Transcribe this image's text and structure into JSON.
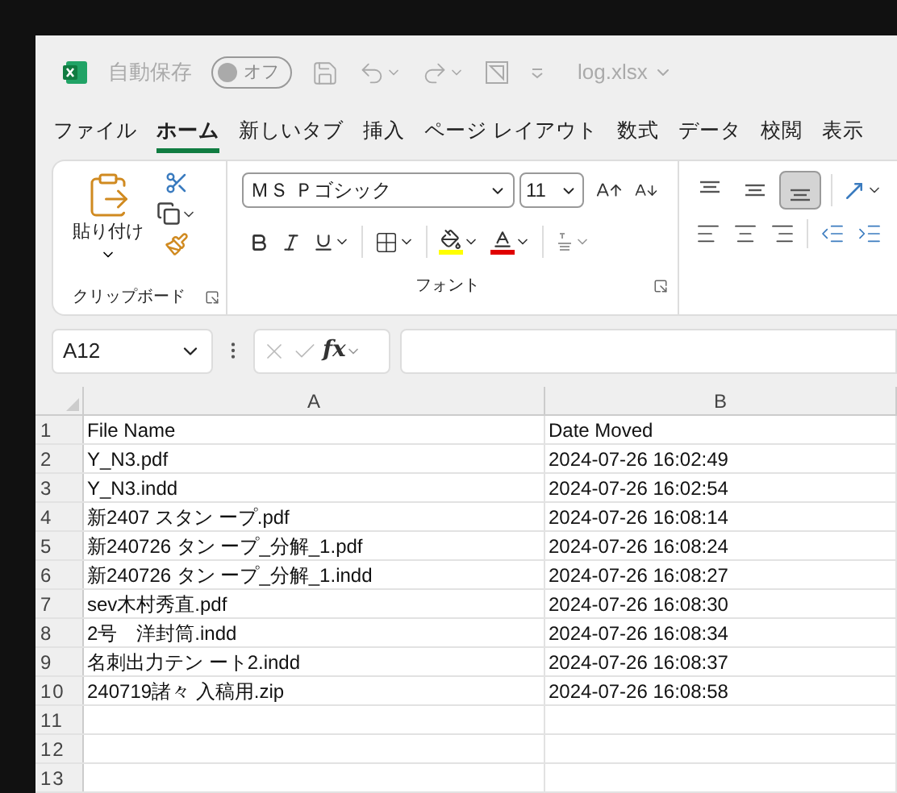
{
  "title_bar": {
    "autosave_label": "自動保存",
    "autosave_toggle": {
      "label": "オフ",
      "on": false
    },
    "filename": "log.xlsx"
  },
  "tabs": [
    {
      "label": "ファイル",
      "selected": false
    },
    {
      "label": "ホーム",
      "selected": true
    },
    {
      "label": "新しいタブ",
      "selected": false
    },
    {
      "label": "挿入",
      "selected": false
    },
    {
      "label": "ページ レイアウト",
      "selected": false
    },
    {
      "label": "数式",
      "selected": false
    },
    {
      "label": "データ",
      "selected": false
    },
    {
      "label": "校閲",
      "selected": false
    },
    {
      "label": "表示",
      "selected": false
    }
  ],
  "ribbon": {
    "clipboard": {
      "paste_label": "貼り付け",
      "group_label": "クリップボード"
    },
    "font": {
      "font_name": "ＭＳ Ｐゴシック",
      "font_size": "11",
      "group_label": "フォント"
    },
    "alignment": {
      "vertical_buttons": [
        {
          "selected": false
        },
        {
          "selected": false
        },
        {
          "selected": true
        }
      ]
    }
  },
  "formula_bar": {
    "name_box": "A12",
    "fx": "fx"
  },
  "sheet": {
    "columns": [
      "A",
      "B"
    ],
    "rows": [
      {
        "number": "1",
        "cells": [
          "File Name",
          "Date Moved"
        ]
      },
      {
        "number": "2",
        "cells": [
          "Y_N3.pdf",
          "2024-07-26 16:02:49"
        ]
      },
      {
        "number": "3",
        "cells": [
          "Y_N3.indd",
          "2024-07-26 16:02:54"
        ]
      },
      {
        "number": "4",
        "cells": [
          "新2407 スタン ープ.pdf",
          "2024-07-26 16:08:14"
        ]
      },
      {
        "number": "5",
        "cells": [
          "新240726 タン ープ_分解_1.pdf",
          "2024-07-26 16:08:24"
        ]
      },
      {
        "number": "6",
        "cells": [
          "新240726 タン ープ_分解_1.indd",
          "2024-07-26 16:08:27"
        ]
      },
      {
        "number": "7",
        "cells": [
          "sev木村秀直.pdf",
          "2024-07-26 16:08:30"
        ]
      },
      {
        "number": "8",
        "cells": [
          "2号　洋封筒.indd",
          "2024-07-26 16:08:34"
        ]
      },
      {
        "number": "9",
        "cells": [
          "名刺出力テン ート2.indd",
          "2024-07-26 16:08:37"
        ]
      },
      {
        "number": "10",
        "cells": [
          "240719諸々 入稿用.zip",
          "2024-07-26 16:08:58"
        ]
      },
      {
        "number": "11",
        "cells": [
          "",
          ""
        ]
      },
      {
        "number": "12",
        "cells": [
          "",
          ""
        ]
      },
      {
        "number": "13",
        "cells": [
          "",
          ""
        ]
      }
    ]
  }
}
